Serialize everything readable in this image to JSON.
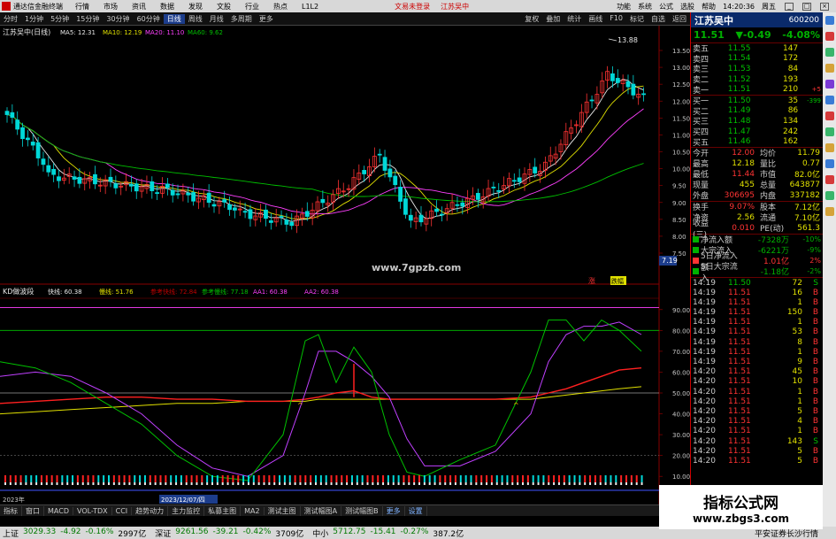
{
  "titlebar": {
    "app_title": "通达信金融终端",
    "menus": [
      "行情",
      "市场",
      "资讯",
      "数据",
      "发现",
      "文股",
      "行业",
      "热点",
      "L1L2"
    ],
    "center": [
      "文易未登录",
      "江苏吴中"
    ],
    "right": [
      "功能",
      "系统",
      "公式",
      "选股",
      "帮助"
    ],
    "time": "14:20:36",
    "period": "周五"
  },
  "toolbar": {
    "items": [
      "分时",
      "1分钟",
      "5分钟",
      "15分钟",
      "30分钟",
      "60分钟",
      "日线",
      "周线",
      "月线",
      "多周期",
      "更多"
    ],
    "active": "日线",
    "right_items": [
      "复权",
      "叠加",
      "统计",
      "画线",
      "F10",
      "标记",
      "自选",
      "返回"
    ]
  },
  "main_chart": {
    "legend_title": "江苏吴中(日线)",
    "ma": [
      {
        "label": "MA5: 12.31",
        "color": "#e8e8e8"
      },
      {
        "label": "MA10: 12.19",
        "color": "#e0e000"
      },
      {
        "label": "MA20: 11.10",
        "color": "#ff40ff"
      },
      {
        "label": "MA60: 9.62",
        "color": "#00c000"
      }
    ],
    "high_label": "13.88",
    "price_axis": [
      "13.50",
      "13.00",
      "12.50",
      "12.00",
      "11.50",
      "11.00",
      "10.50",
      "10.00",
      "9.50",
      "9.00",
      "8.50",
      "8.00",
      "7.50"
    ],
    "price_tag": "7.19",
    "marks": [
      "涨",
      "跌幅"
    ]
  },
  "indicator": {
    "name": "KD做波段",
    "values": [
      {
        "label": "快线: 60.38",
        "color": "#e8e8e8"
      },
      {
        "label": "慢线: 51.76",
        "color": "#e0e000"
      },
      {
        "label": "参考快线: 72.84",
        "color": "#c00000"
      },
      {
        "label": "参考慢线: 77.18",
        "color": "#00c000"
      },
      {
        "label": "AA1: 60.38",
        "color": "#ff40ff"
      },
      {
        "label": "AA2: 60.38",
        "color": "#ff40ff"
      }
    ],
    "axis": [
      "90.00",
      "80.00",
      "70.00",
      "60.00",
      "50.00",
      "40.00",
      "30.00",
      "20.00",
      "10.00"
    ],
    "date_label": "2023年",
    "date_tag": "2023/12/07/四"
  },
  "tabs": [
    "指标",
    "窗口",
    "MACD",
    "VOL-TDX",
    "CCI",
    "趋势动力",
    "主力监控",
    "私募主图",
    "MA2",
    "测试主图",
    "测试幅图A",
    "测试幅图B",
    "更多",
    "设置"
  ],
  "watermark": {
    "site1": "www.7gpzb.com",
    "cn": "指标公式网",
    "site2": "www.zbgs3.com"
  },
  "status": [
    {
      "name": "上证",
      "price": "3029.33",
      "chg": "-4.92",
      "pct": "-0.16%",
      "amt": "2997亿"
    },
    {
      "name": "深证",
      "price": "9261.56",
      "chg": "-39.21",
      "pct": "-0.42%",
      "amt": "3709亿"
    },
    {
      "name": "中小",
      "price": "5712.75",
      "chg": "-15.41",
      "pct": "-0.27%",
      "amt": "387.2亿"
    }
  ],
  "status_right": "平安证券长沙行情",
  "quote": {
    "name": "江苏吴中",
    "code": "600200",
    "price": "11.51",
    "change": "▼-0.49",
    "pct": "-4.08%",
    "asks": [
      {
        "label": "卖五",
        "price": "11.55",
        "vol": "147",
        "chg": ""
      },
      {
        "label": "卖四",
        "price": "11.54",
        "vol": "172",
        "chg": ""
      },
      {
        "label": "卖三",
        "price": "11.53",
        "vol": "84",
        "chg": ""
      },
      {
        "label": "卖二",
        "price": "11.52",
        "vol": "193",
        "chg": ""
      },
      {
        "label": "卖一",
        "price": "11.51",
        "vol": "210",
        "chg": "+5"
      }
    ],
    "bids": [
      {
        "label": "买一",
        "price": "11.50",
        "vol": "35",
        "chg": "-399"
      },
      {
        "label": "买二",
        "price": "11.49",
        "vol": "86",
        "chg": ""
      },
      {
        "label": "买三",
        "price": "11.48",
        "vol": "134",
        "chg": ""
      },
      {
        "label": "买四",
        "price": "11.47",
        "vol": "242",
        "chg": ""
      },
      {
        "label": "买五",
        "price": "11.46",
        "vol": "162",
        "chg": ""
      }
    ],
    "stats": [
      {
        "k": "今开",
        "v": "12.00",
        "k2": "均价",
        "v2": "11.79"
      },
      {
        "k": "最高",
        "v": "12.18",
        "k2": "量比",
        "v2": "0.77"
      },
      {
        "k": "最低",
        "v": "11.44",
        "k2": "市值",
        "v2": "82.0亿"
      },
      {
        "k": "现量",
        "v": "455",
        "k2": "总量",
        "v2": "643877"
      },
      {
        "k": "外盘",
        "v": "306695",
        "k2": "内盘",
        "v2": "337182"
      }
    ],
    "stats2": [
      {
        "k": "换手",
        "v": "9.07%",
        "k2": "股本",
        "v2": "7.12亿"
      },
      {
        "k": "净资",
        "v": "2.56",
        "k2": "流通",
        "v2": "7.10亿"
      },
      {
        "k": "收益(三)",
        "v": "0.010",
        "k2": "PE(动)",
        "v2": "561.3"
      }
    ],
    "flows": [
      {
        "label": "净流入额",
        "val": "-7328万",
        "pct": "-10%",
        "color": "#00b000"
      },
      {
        "label": "大宗流入",
        "val": "-6221万",
        "pct": "-9%",
        "color": "#00b000"
      },
      {
        "label": "5日净流入额",
        "val": "1.01亿",
        "pct": "2%",
        "color": "#ff3333"
      },
      {
        "label": "5日大宗流入",
        "val": "-1.18亿",
        "pct": "-2%",
        "color": "#00b000"
      }
    ],
    "ticks": [
      {
        "t": "14:19",
        "p": "11.50",
        "v": "72",
        "bs": "S"
      },
      {
        "t": "14:19",
        "p": "11.51",
        "v": "16",
        "bs": "B"
      },
      {
        "t": "14:19",
        "p": "11.51",
        "v": "1",
        "bs": "B"
      },
      {
        "t": "14:19",
        "p": "11.51",
        "v": "150",
        "bs": "B"
      },
      {
        "t": "14:19",
        "p": "11.51",
        "v": "1",
        "bs": "B"
      },
      {
        "t": "14:19",
        "p": "11.51",
        "v": "53",
        "bs": "B"
      },
      {
        "t": "14:19",
        "p": "11.51",
        "v": "8",
        "bs": "B"
      },
      {
        "t": "14:19",
        "p": "11.51",
        "v": "1",
        "bs": "B"
      },
      {
        "t": "14:19",
        "p": "11.51",
        "v": "9",
        "bs": "B"
      },
      {
        "t": "14:20",
        "p": "11.51",
        "v": "45",
        "bs": "B"
      },
      {
        "t": "14:20",
        "p": "11.51",
        "v": "10",
        "bs": "B"
      },
      {
        "t": "14:20",
        "p": "11.51",
        "v": "1",
        "bs": "B"
      },
      {
        "t": "14:20",
        "p": "11.51",
        "v": "1",
        "bs": "B"
      },
      {
        "t": "14:20",
        "p": "11.51",
        "v": "5",
        "bs": "B"
      },
      {
        "t": "14:20",
        "p": "11.51",
        "v": "4",
        "bs": "B"
      },
      {
        "t": "14:20",
        "p": "11.51",
        "v": "1",
        "bs": "B"
      },
      {
        "t": "14:20",
        "p": "11.51",
        "v": "143",
        "bs": "S"
      },
      {
        "t": "14:20",
        "p": "11.51",
        "v": "5",
        "bs": "B"
      },
      {
        "t": "14:20",
        "p": "11.51",
        "v": "5",
        "bs": "B"
      }
    ]
  }
}
